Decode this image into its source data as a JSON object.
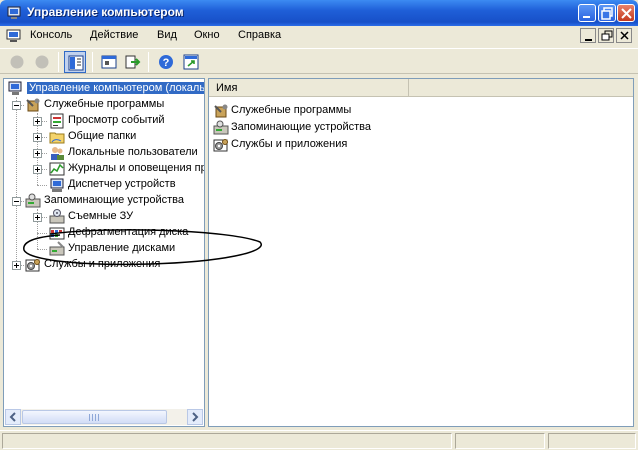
{
  "window": {
    "title": "Управление компьютером"
  },
  "menu": [
    "Консоль",
    "Действие",
    "Вид",
    "Окно",
    "Справка"
  ],
  "tree": {
    "root": "Управление компьютером (локаль",
    "items": [
      "Служебные программы",
      "Просмотр событий",
      "Общие папки",
      "Локальные пользователи",
      "Журналы и оповещения пр",
      "Диспетчер устройств",
      "Запоминающие устройства",
      "Съемные ЗУ",
      "Дефрагментация диска",
      "Управление дисками",
      "Службы и приложения"
    ]
  },
  "list": {
    "column": "Имя",
    "rows": [
      "Служебные программы",
      "Запоминающие устройства",
      "Службы и приложения"
    ]
  },
  "colors": {
    "titlebar": "#1f5fd8",
    "selection": "#316ac5",
    "annotation": "#000000"
  },
  "icons": [
    "computer-icon",
    "tools-icon",
    "event-viewer-icon",
    "shared-folder-icon",
    "users-icon",
    "performance-icon",
    "device-manager-icon",
    "storage-icon",
    "removable-storage-icon",
    "defrag-icon",
    "disk-management-icon",
    "services-icon"
  ]
}
